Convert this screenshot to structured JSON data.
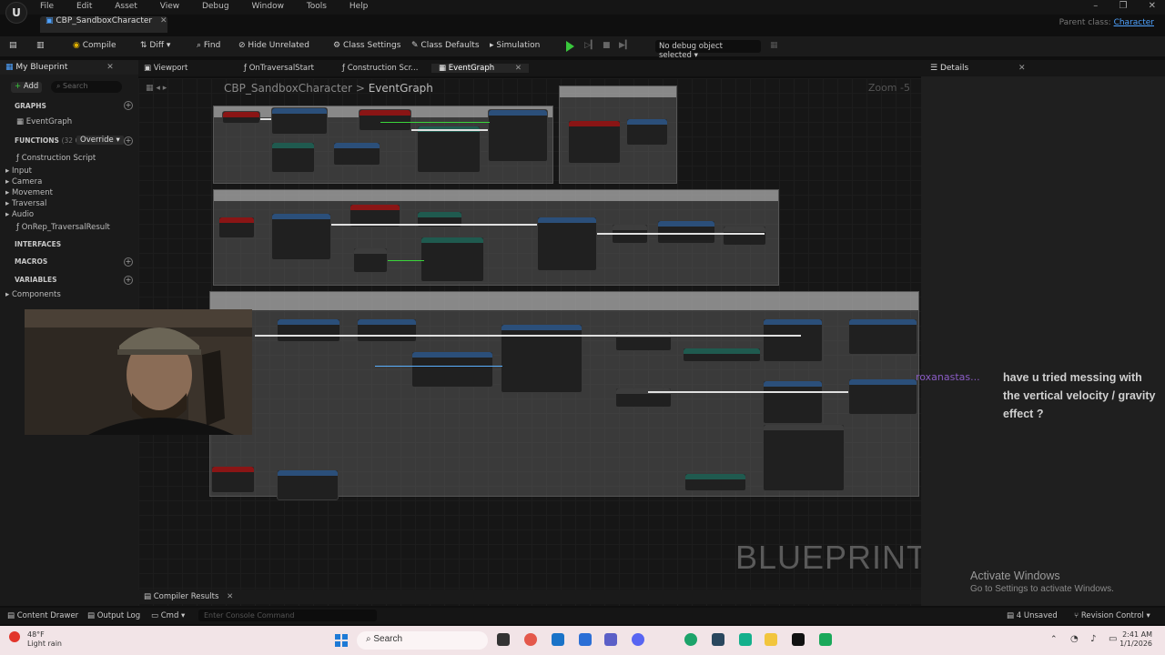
{
  "menu": [
    "File",
    "Edit",
    "Asset",
    "View",
    "Debug",
    "Window",
    "Tools",
    "Help"
  ],
  "asset_tab": "CBP_SandboxCharacter",
  "parent_class": {
    "label": "Parent class:",
    "value": "Character"
  },
  "toolbar": {
    "compile": "Compile",
    "diff": "Diff",
    "find": "Find",
    "hide_unrelated": "Hide Unrelated",
    "class_settings": "Class Settings",
    "class_defaults": "Class Defaults",
    "simulation": "Simulation",
    "debug_selector": "No debug object selected"
  },
  "my_blueprint": {
    "title": "My Blueprint",
    "add": "Add",
    "search_placeholder": "Search",
    "graphs_header": "GRAPHS",
    "event_graph": "EventGraph",
    "functions_header": "FUNCTIONS",
    "functions_count": "(32 OV",
    "override": "Override",
    "function_items": [
      "Construction Script",
      "Input",
      "Camera",
      "Movement",
      "Traversal",
      "Audio",
      "OnRep_TraversalResult"
    ],
    "interfaces_header": "INTERFACES",
    "macros_header": "MACROS",
    "variables_header": "VARIABLES",
    "variable_items": [
      "Components"
    ]
  },
  "graph_tabs": [
    "Viewport",
    "OnTraversalStart",
    "Construction Scr...",
    "EventGraph"
  ],
  "graph": {
    "breadcrumb_class": "CBP_SandboxCharacter",
    "breadcrumb_sep": ">",
    "breadcrumb_graph": "EventGraph",
    "zoom": "Zoom -5",
    "watermark": "BLUEPRINT"
  },
  "details": {
    "title": "Details"
  },
  "chat": {
    "user": "roxanastas...",
    "message": "have u tried messing with the vertical velocity / gravity effect ?"
  },
  "activate": {
    "title": "Activate Windows",
    "subtitle": "Go to Settings to activate Windows."
  },
  "compiler_tab": "Compiler Results",
  "bottom_bar": {
    "content_drawer": "Content Drawer",
    "output_log": "Output Log",
    "cmd": "Cmd",
    "console_placeholder": "Enter Console Command",
    "unsaved": "4 Unsaved",
    "revision_control": "Revision Control"
  },
  "taskbar": {
    "weather_temp": "48°F",
    "weather_desc": "Light rain",
    "search": "Search",
    "time": "2:41 AM",
    "date": "1/1/2026"
  }
}
